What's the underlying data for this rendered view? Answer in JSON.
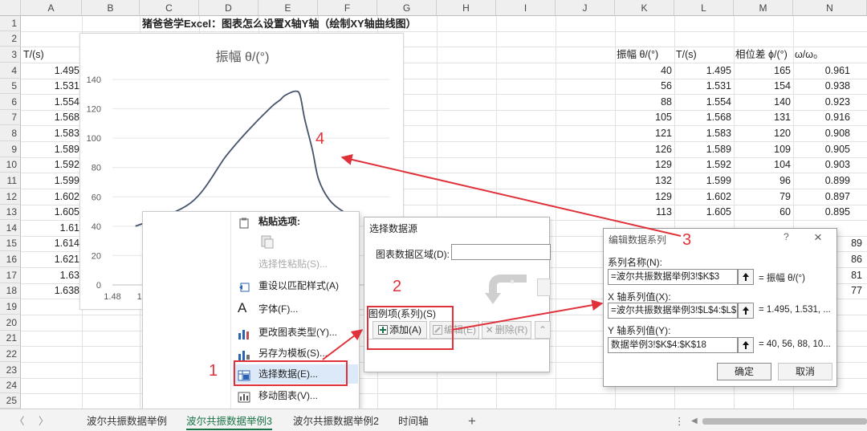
{
  "sheet": {
    "columns": [
      "A",
      "B",
      "C",
      "D",
      "E",
      "F",
      "G",
      "H",
      "I",
      "J",
      "K",
      "L",
      "M",
      "N"
    ],
    "rows": [
      "1",
      "2",
      "3",
      "4",
      "5",
      "6",
      "7",
      "8",
      "9",
      "10",
      "11",
      "12",
      "13",
      "14",
      "15",
      "16",
      "17",
      "18",
      "19",
      "20",
      "21",
      "22",
      "23",
      "24",
      "25"
    ],
    "title": "猪爸爸学Excel：图表怎么设置X轴Y轴（绘制XY轴曲线图）",
    "col_a_header": "T/(s)",
    "col_a_values": [
      "1.495",
      "1.531",
      "1.554",
      "1.568",
      "1.583",
      "1.589",
      "1.592",
      "1.599",
      "1.602",
      "1.605",
      "1.61",
      "1.614",
      "1.621",
      "1.63",
      "1.638"
    ],
    "right_headers": {
      "k": "振幅 θ/(°)",
      "l": "T/(s)",
      "m": "相位差 ϕ/(°)",
      "n": "ω/ω₀"
    },
    "right_rows": [
      [
        "40",
        "1.495",
        "165",
        "0.961"
      ],
      [
        "56",
        "1.531",
        "154",
        "0.938"
      ],
      [
        "88",
        "1.554",
        "140",
        "0.923"
      ],
      [
        "105",
        "1.568",
        "131",
        "0.916"
      ],
      [
        "121",
        "1.583",
        "120",
        "0.908"
      ],
      [
        "126",
        "1.589",
        "109",
        "0.905"
      ],
      [
        "129",
        "1.592",
        "104",
        "0.903"
      ],
      [
        "132",
        "1.599",
        "96",
        "0.899"
      ],
      [
        "129",
        "1.602",
        "79",
        "0.897"
      ],
      [
        "113",
        "1.605",
        "60",
        "0.895"
      ]
    ],
    "right_partial_n": [
      "89",
      "86",
      "81",
      "77"
    ]
  },
  "chart_data": {
    "type": "line",
    "title": "振幅 θ/(°)",
    "y_ticks": [
      "140",
      "120",
      "100",
      "80",
      "60",
      "40",
      "20",
      "0"
    ],
    "x_ticks": [
      "1.48",
      "1.5"
    ],
    "ylim": [
      0,
      140
    ],
    "series": [
      {
        "x": [
          1.495,
          1.531,
          1.554,
          1.568,
          1.583,
          1.589,
          1.592,
          1.599,
          1.602,
          1.605,
          1.61,
          1.614,
          1.621,
          1.63,
          1.638
        ],
        "values": [
          40,
          56,
          88,
          105,
          121,
          126,
          129,
          132,
          129,
          113,
          92,
          72,
          58,
          50,
          46
        ]
      }
    ],
    "color": "#44546a"
  },
  "context_menu": {
    "paste_options": "粘贴选项:",
    "items": [
      {
        "label": "选择性粘贴(S)...",
        "icon": "paste-special-icon",
        "disabled": true
      },
      {
        "label": "重设以匹配样式(A)",
        "icon": "reset-style-icon"
      },
      {
        "label": "字体(F)...",
        "icon": "font-icon"
      },
      {
        "label": "更改图表类型(Y)...",
        "icon": "chart-type-icon"
      },
      {
        "label": "另存为模板(S)...",
        "icon": "save-template-icon"
      },
      {
        "label": "选择数据(E)...",
        "icon": "select-data-icon"
      },
      {
        "label": "移动图表(V)...",
        "icon": "move-chart-icon"
      }
    ]
  },
  "select_source": {
    "title": "选择数据源",
    "range_label": "图表数据区域(D):",
    "legend_label": "图例项(系列)(S)",
    "add": "添加(A)",
    "edit": "编辑(E)",
    "delete": "删除(R)"
  },
  "edit_series": {
    "title": "编辑数据系列",
    "help": "?",
    "close": "×",
    "name_label": "系列名称(N):",
    "name_value": "=波尔共振数据举例3!$K$3",
    "name_preview": "= 振幅 θ/(°)",
    "x_label": "X 轴系列值(X):",
    "x_value": "=波尔共振数据举例3!$L$4:$L$1",
    "x_preview": "= 1.495, 1.531, ...",
    "y_label": "Y 轴系列值(Y):",
    "y_value": "数据举例3!$K$4:$K$18",
    "y_preview": "= 40, 56, 88, 10...",
    "ok": "确定",
    "cancel": "取消"
  },
  "annotations": {
    "n1": "1",
    "n2": "2",
    "n3": "3",
    "n4": "4",
    "color": "#e0313a"
  },
  "tabs": {
    "items": [
      "波尔共振数据举例",
      "波尔共振数据举例3",
      "波尔共振数据举例2",
      "时间轴"
    ],
    "active": 1,
    "add": "+"
  }
}
